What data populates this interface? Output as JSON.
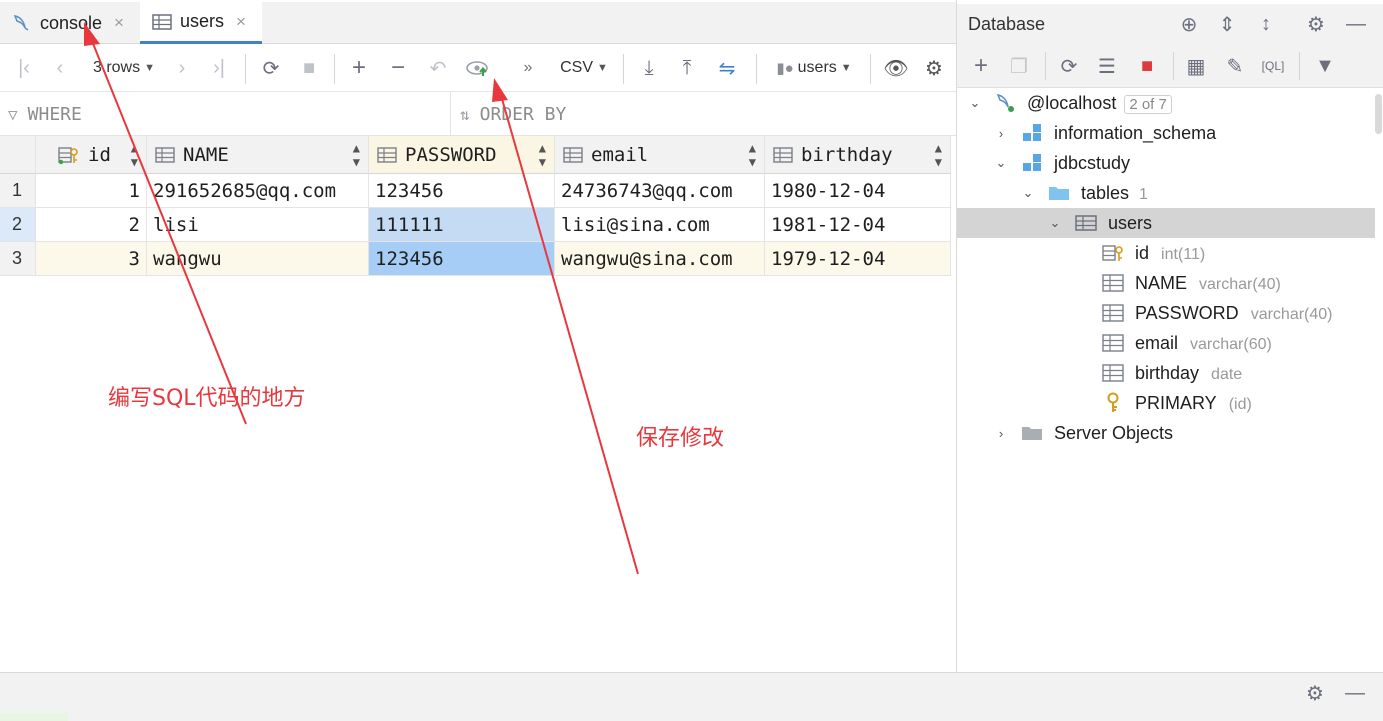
{
  "tabs": [
    {
      "label": "console",
      "close": "×"
    },
    {
      "label": "users",
      "close": "×"
    }
  ],
  "toolbar": {
    "rows_label": "3 rows",
    "more": "»",
    "format": "CSV",
    "table_select": "users"
  },
  "filter": {
    "where": "WHERE",
    "order_by": "ORDER BY"
  },
  "grid": {
    "columns": [
      "id",
      "NAME",
      "PASSWORD",
      "email",
      "birthday"
    ],
    "rows": [
      {
        "num": "1",
        "id": "1",
        "NAME": "291652685@qq.com",
        "PASSWORD": "123456",
        "email": "24736743@qq.com",
        "birthday": "1980-12-04"
      },
      {
        "num": "2",
        "id": "2",
        "NAME": "lisi",
        "PASSWORD": "111111",
        "email": "lisi@sina.com",
        "birthday": "1981-12-04"
      },
      {
        "num": "3",
        "id": "3",
        "NAME": "wangwu",
        "PASSWORD": "123456",
        "email": "wangwu@sina.com",
        "birthday": "1979-12-04"
      }
    ]
  },
  "annotations": {
    "sql_code": "编写SQL代码的地方",
    "save_changes": "保存修改"
  },
  "database": {
    "title": "Database",
    "host": "@localhost",
    "host_badge": "2 of 7",
    "schemas": [
      "information_schema",
      "jdbcstudy"
    ],
    "tables_label": "tables",
    "tables_count": "1",
    "table": "users",
    "columns": [
      {
        "name": "id",
        "type": "int(11)"
      },
      {
        "name": "NAME",
        "type": "varchar(40)"
      },
      {
        "name": "PASSWORD",
        "type": "varchar(40)"
      },
      {
        "name": "email",
        "type": "varchar(60)"
      },
      {
        "name": "birthday",
        "type": "date"
      }
    ],
    "key": {
      "name": "PRIMARY",
      "cols": "(id)"
    },
    "server_objects": "Server Objects"
  },
  "colors": {
    "accent": "#4083c9",
    "selected_row": "#dce9f8",
    "selected_cell": "#a6cdf5",
    "annotation": "#e8383d"
  }
}
